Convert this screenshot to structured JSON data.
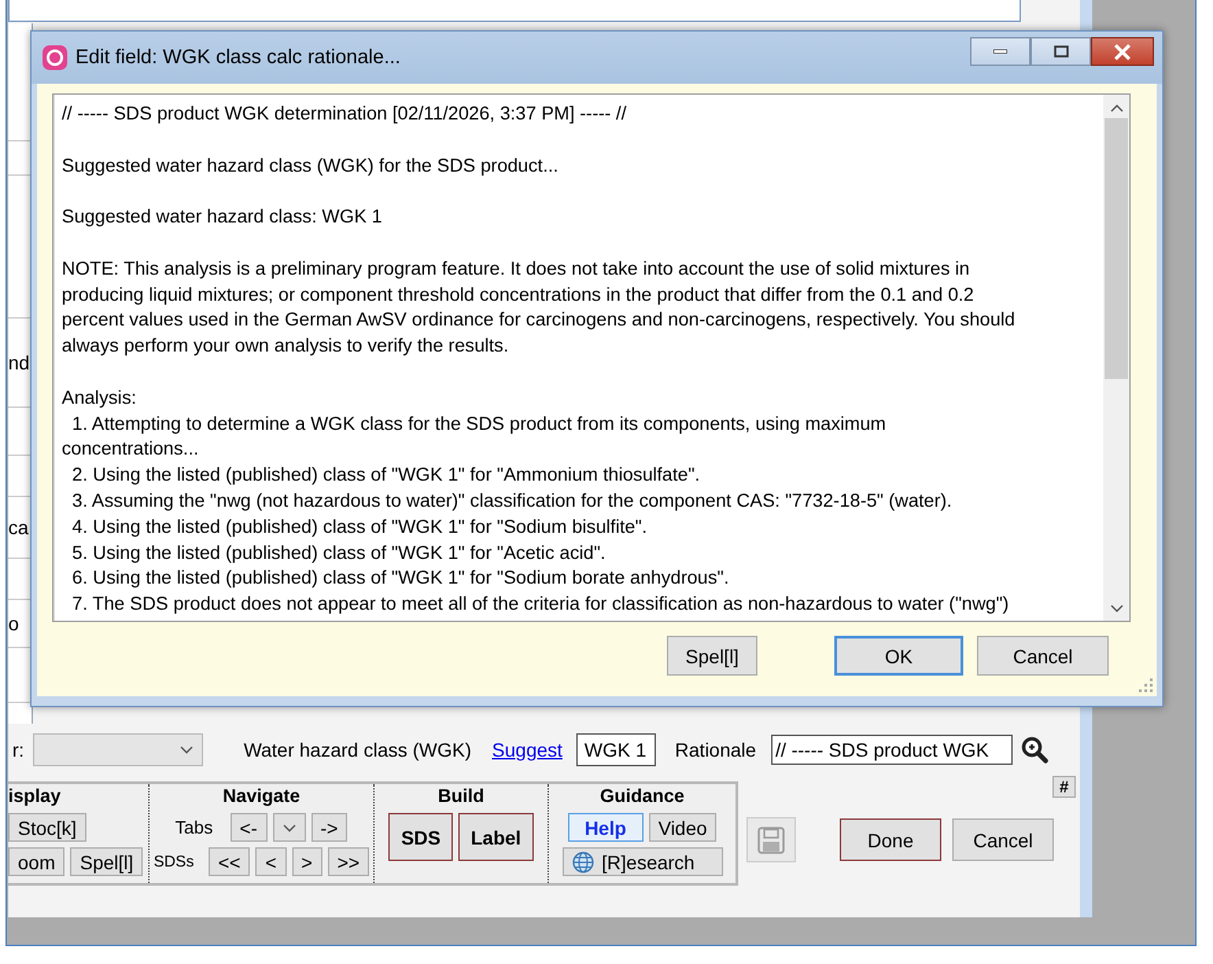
{
  "base_window": {
    "side_fragments": [
      "nd",
      "ca",
      "o"
    ],
    "combo_label": "r:",
    "wgk_label": "Water hazard class (WGK)",
    "suggest_link": "Suggest",
    "wgk_value": "WGK 1",
    "rationale_label": "Rationale",
    "rationale_value": "// ----- SDS product WGK",
    "groups": [
      {
        "title": "isplay",
        "rows": [
          {
            "buttons": [
              {
                "label": "Stoc[k]",
                "kind": "plain"
              }
            ]
          },
          {
            "buttons": [
              {
                "label": "oom",
                "kind": "plain"
              },
              {
                "label": "Spel[l]",
                "kind": "plain"
              }
            ]
          }
        ]
      },
      {
        "title": "Navigate",
        "rows": [
          {
            "label": "Tabs",
            "buttons": [
              {
                "label": "<-",
                "kind": "plain"
              },
              {
                "kind": "chevron"
              },
              {
                "label": "->",
                "kind": "plain"
              }
            ]
          },
          {
            "label": "SDSs",
            "buttons": [
              {
                "label": "<<",
                "kind": "plain"
              },
              {
                "label": "<",
                "kind": "plain"
              },
              {
                "label": ">",
                "kind": "plain"
              },
              {
                "label": ">>",
                "kind": "plain"
              }
            ]
          }
        ]
      },
      {
        "title": "Build",
        "rows": [
          {
            "buttons": [
              {
                "label": "SDS",
                "kind": "bold"
              },
              {
                "label": "Label",
                "kind": "bold"
              }
            ]
          }
        ]
      },
      {
        "title": "Guidance",
        "rows": [
          {
            "buttons": [
              {
                "label": "Help",
                "kind": "accent"
              },
              {
                "label": "Video",
                "kind": "plain"
              }
            ]
          },
          {
            "buttons": [
              {
                "label": "[R]esearch",
                "kind": "globe"
              }
            ]
          }
        ]
      }
    ],
    "hash_button": "#",
    "actions": [
      {
        "kind": "save",
        "disabled": true
      },
      {
        "label": "Done",
        "kind": "framed"
      },
      {
        "label": "Cancel",
        "kind": "plain"
      }
    ]
  },
  "dialog": {
    "title": "Edit field: WGK class calc rationale...",
    "paragraphs": [
      [
        "// ----- SDS product WGK determination [02/11/2026, 3:37 PM] ----- //"
      ],
      [
        "Suggested water hazard class (WGK) for the SDS product..."
      ],
      [
        "Suggested water hazard class: WGK 1"
      ],
      [
        "NOTE: This analysis is a preliminary program feature. It does not take into account the use of solid mixtures in",
        "producing liquid mixtures; or component threshold concentrations in the product that differ from the 0.1 and 0.2",
        "percent values used in the German AwSV ordinance for carcinogens and non-carcinogens, respectively. You should",
        "always perform your own analysis to verify the results."
      ],
      [
        "Analysis:",
        "  1. Attempting to determine a WGK class for the SDS product from its components, using maximum",
        "concentrations...",
        "  2. Using the listed (published) class of \"WGK 1\" for \"Ammonium thiosulfate\".",
        "  3. Assuming the \"nwg (not hazardous to water)\" classification for the component CAS: \"7732-18-5\" (water).",
        "  4. Using the listed (published) class of \"WGK 1\" for \"Sodium bisulfite\".",
        "  5. Using the listed (published) class of \"WGK 1\" for \"Acetic acid\".",
        "  6. Using the listed (published) class of \"WGK 1\" for \"Sodium borate anhydrous\".",
        "  7. The SDS product does not appear to meet all of the criteria for classification as non-hazardous to water (\"nwg\")"
      ]
    ],
    "buttons": [
      {
        "label": "Spel[l]",
        "default": false
      },
      {
        "label": "OK",
        "default": true
      },
      {
        "label": "Cancel",
        "default": false
      }
    ]
  }
}
